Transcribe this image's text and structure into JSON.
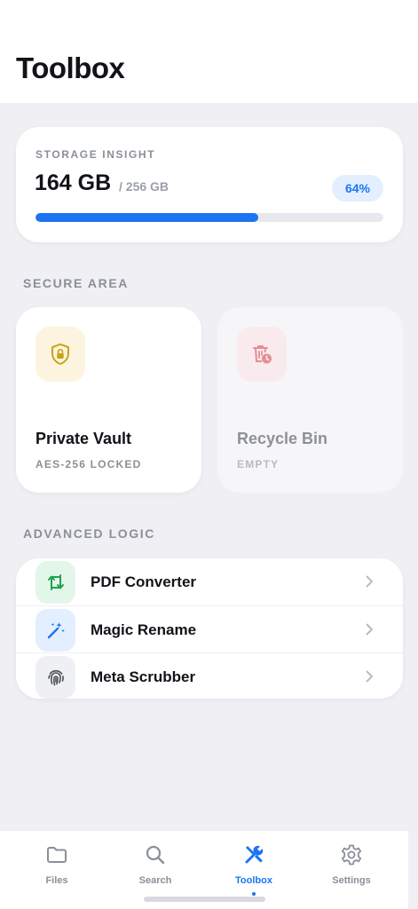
{
  "header": {
    "title": "Toolbox"
  },
  "storage": {
    "caption": "STORAGE INSIGHT",
    "used": "164 GB",
    "total": "/ 256 GB",
    "percent_label": "64%",
    "progress": 0.64
  },
  "secure_area": {
    "heading": "SECURE AREA",
    "tiles": [
      {
        "title": "Private Vault",
        "subtitle": "AES-256 LOCKED",
        "icon": "shield-lock-icon"
      },
      {
        "title": "Recycle Bin",
        "subtitle": "EMPTY",
        "icon": "trash-clock-icon"
      }
    ]
  },
  "advanced_logic": {
    "heading": "ADVANCED LOGIC",
    "items": [
      {
        "label": "PDF Converter",
        "icon": "convert-arrows-icon"
      },
      {
        "label": "Magic Rename",
        "icon": "magic-wand-icon"
      },
      {
        "label": "Meta Scrubber",
        "icon": "fingerprint-icon"
      }
    ]
  },
  "tabbar": {
    "tabs": [
      {
        "label": "Files",
        "icon": "folder-icon"
      },
      {
        "label": "Search",
        "icon": "search-icon"
      },
      {
        "label": "Toolbox",
        "icon": "tools-icon",
        "active": true
      },
      {
        "label": "Settings",
        "icon": "gear-icon"
      }
    ]
  },
  "colors": {
    "accent": "#1d74f2",
    "background": "#f0f0f4",
    "vault_tint": "#fcf4de",
    "bin_tint": "#fbe7e9",
    "convert_tint": "#e3f6ea",
    "rename_tint": "#e3efff",
    "scrub_tint": "#eef0f4"
  }
}
